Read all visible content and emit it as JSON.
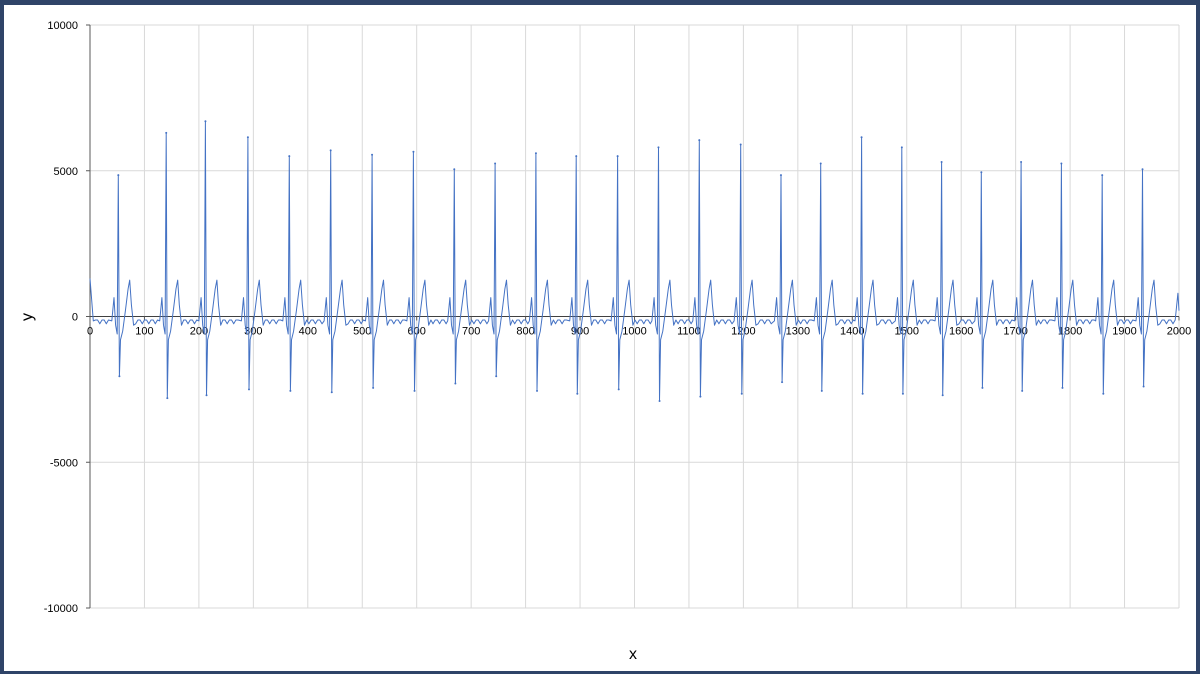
{
  "chart_data": {
    "type": "line",
    "title": "",
    "xlabel": "x",
    "ylabel": "y",
    "xlim": [
      0,
      2000
    ],
    "ylim": [
      -10000,
      10000
    ],
    "xticks": [
      "0",
      "100",
      "200",
      "300",
      "400",
      "500",
      "600",
      "700",
      "800",
      "900",
      "1000",
      "1100",
      "1200",
      "1300",
      "1400",
      "1500",
      "1600",
      "1700",
      "1800",
      "1900",
      "2000"
    ],
    "yticks": [
      "10000",
      "5000",
      "0",
      "-5000",
      "-10000"
    ],
    "grid": true,
    "legend": "none",
    "series": [
      {
        "color": "#4472c4",
        "beats": [
          {
            "x": 52,
            "peak": 4850,
            "trough": -2050
          },
          {
            "x": 140,
            "peak": 6300,
            "trough": -2800
          },
          {
            "x": 212,
            "peak": 6700,
            "trough": -2700
          },
          {
            "x": 290,
            "peak": 6150,
            "trough": -2500
          },
          {
            "x": 366,
            "peak": 5500,
            "trough": -2550
          },
          {
            "x": 442,
            "peak": 5700,
            "trough": -2600
          },
          {
            "x": 518,
            "peak": 5550,
            "trough": -2450
          },
          {
            "x": 594,
            "peak": 5650,
            "trough": -2550
          },
          {
            "x": 669,
            "peak": 5050,
            "trough": -2300
          },
          {
            "x": 744,
            "peak": 5250,
            "trough": -2050
          },
          {
            "x": 819,
            "peak": 5600,
            "trough": -2550
          },
          {
            "x": 893,
            "peak": 5500,
            "trough": -2650
          },
          {
            "x": 969,
            "peak": 5500,
            "trough": -2500
          },
          {
            "x": 1044,
            "peak": 5800,
            "trough": -2900
          },
          {
            "x": 1119,
            "peak": 6050,
            "trough": -2750
          },
          {
            "x": 1195,
            "peak": 5900,
            "trough": -2650
          },
          {
            "x": 1269,
            "peak": 4850,
            "trough": -2250
          },
          {
            "x": 1342,
            "peak": 5250,
            "trough": -2550
          },
          {
            "x": 1417,
            "peak": 6150,
            "trough": -2650
          },
          {
            "x": 1491,
            "peak": 5800,
            "trough": -2650
          },
          {
            "x": 1564,
            "peak": 5300,
            "trough": -2700
          },
          {
            "x": 1637,
            "peak": 4950,
            "trough": -2450
          },
          {
            "x": 1710,
            "peak": 5300,
            "trough": -2550
          },
          {
            "x": 1784,
            "peak": 5250,
            "trough": -2450
          },
          {
            "x": 1859,
            "peak": 4850,
            "trough": -2650
          },
          {
            "x": 1933,
            "peak": 5050,
            "trough": -2400
          }
        ],
        "start_value": 1300,
        "end_value": 800
      }
    ]
  }
}
